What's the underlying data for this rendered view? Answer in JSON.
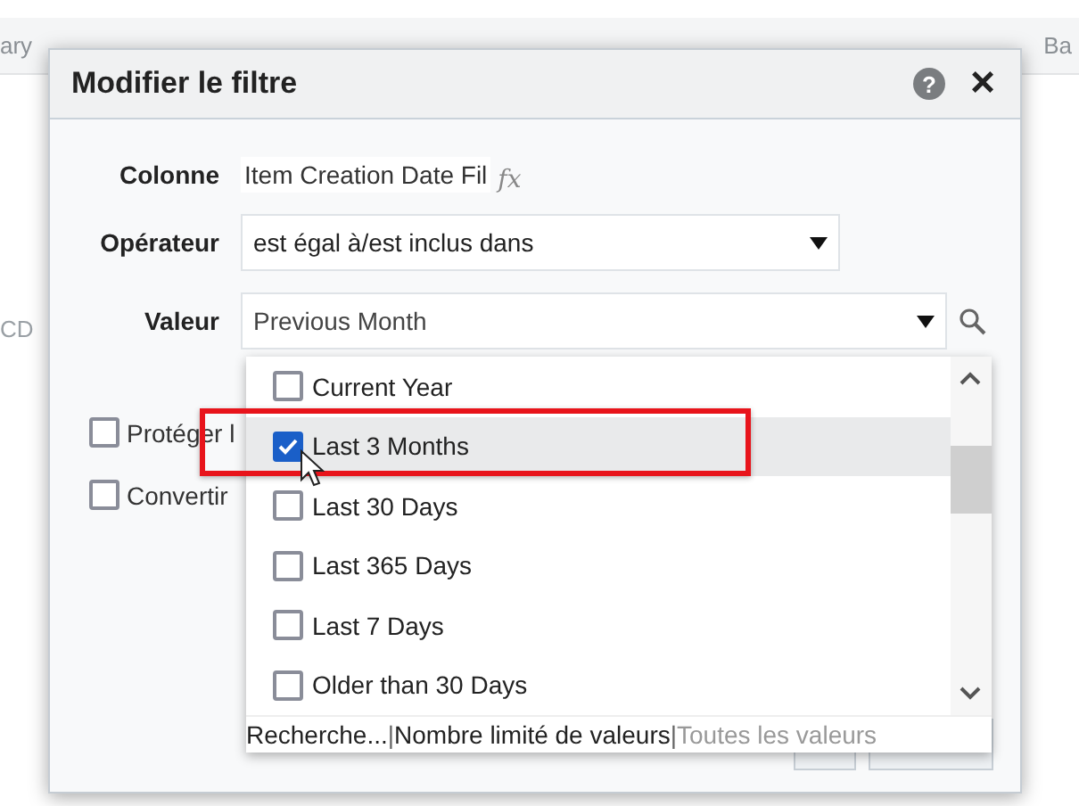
{
  "background": {
    "tabs": [
      {
        "label": "ary"
      },
      {
        "label": "Ba"
      }
    ],
    "side_text": "CD"
  },
  "dialog": {
    "title": "Modifier le filtre",
    "help": "?",
    "close": "×",
    "column": {
      "label": "Colonne",
      "value": "Item Creation Date Fil",
      "formula": "fx"
    },
    "operator": {
      "label": "Opérateur",
      "value": "est égal à/est inclus dans"
    },
    "value": {
      "label": "Valeur",
      "value": "Previous Month"
    },
    "options": [
      {
        "label": "Protéger l",
        "checked": false
      },
      {
        "label": "Convertir",
        "checked": false
      }
    ]
  },
  "dropdown": {
    "items": [
      {
        "label": "Current Year",
        "checked": false,
        "hovered": false
      },
      {
        "label": "Last 3 Months",
        "checked": true,
        "hovered": true
      },
      {
        "label": "Last 30 Days",
        "checked": false,
        "hovered": false
      },
      {
        "label": "Last 365 Days",
        "checked": false,
        "hovered": false
      },
      {
        "label": "Last 7 Days",
        "checked": false,
        "hovered": false
      },
      {
        "label": "Older than 30 Days",
        "checked": false,
        "hovered": false
      }
    ],
    "footer": {
      "separator": "|",
      "links": [
        {
          "label": "Recherche...",
          "disabled": false
        },
        {
          "label": "Nombre limité de valeurs",
          "disabled": false
        },
        {
          "label": "Toutes les valeurs",
          "disabled": true
        }
      ]
    }
  }
}
